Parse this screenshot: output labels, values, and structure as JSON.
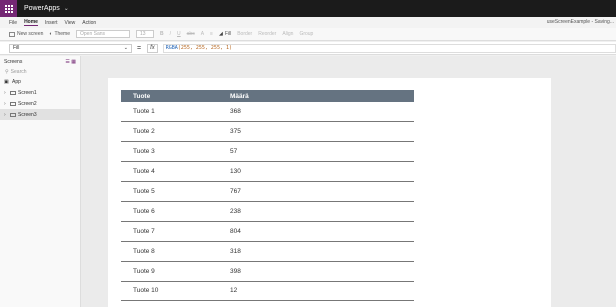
{
  "app": {
    "name": "PowerApps",
    "doc_title": "useScreenExample - Saving..."
  },
  "menu": [
    "File",
    "Home",
    "Insert",
    "View",
    "Action"
  ],
  "ribbon": {
    "new_screen": "New screen",
    "theme": "Theme",
    "font": "Open Sans",
    "font_size": "13",
    "bold": "B",
    "italic": "/",
    "underline": "U",
    "strike": "abc",
    "fontcolor": "A",
    "align": "≡",
    "fill": "Fill",
    "border": "Border",
    "reorder": "Reorder",
    "align_btn": "Align",
    "group": "Group"
  },
  "formula_bar": {
    "property": "Fill",
    "equals": "=",
    "fx": "fx",
    "fn": "RGBA",
    "args": "(255, 255, 255, 1)"
  },
  "sidebar": {
    "title": "Screens",
    "search_placeholder": "Search",
    "app_item": "App",
    "screens": [
      "Screen1",
      "Screen2",
      "Screen3"
    ],
    "selected": 2
  },
  "table": {
    "headers": [
      "Tuote",
      "Määrä"
    ],
    "rows": [
      [
        "Tuote 1",
        "368"
      ],
      [
        "Tuote 2",
        "375"
      ],
      [
        "Tuote 3",
        "57"
      ],
      [
        "Tuote 4",
        "130"
      ],
      [
        "Tuote 5",
        "767"
      ],
      [
        "Tuote 6",
        "238"
      ],
      [
        "Tuote 7",
        "804"
      ],
      [
        "Tuote 8",
        "318"
      ],
      [
        "Tuote 9",
        "398"
      ],
      [
        "Tuote 10",
        "12"
      ]
    ]
  }
}
